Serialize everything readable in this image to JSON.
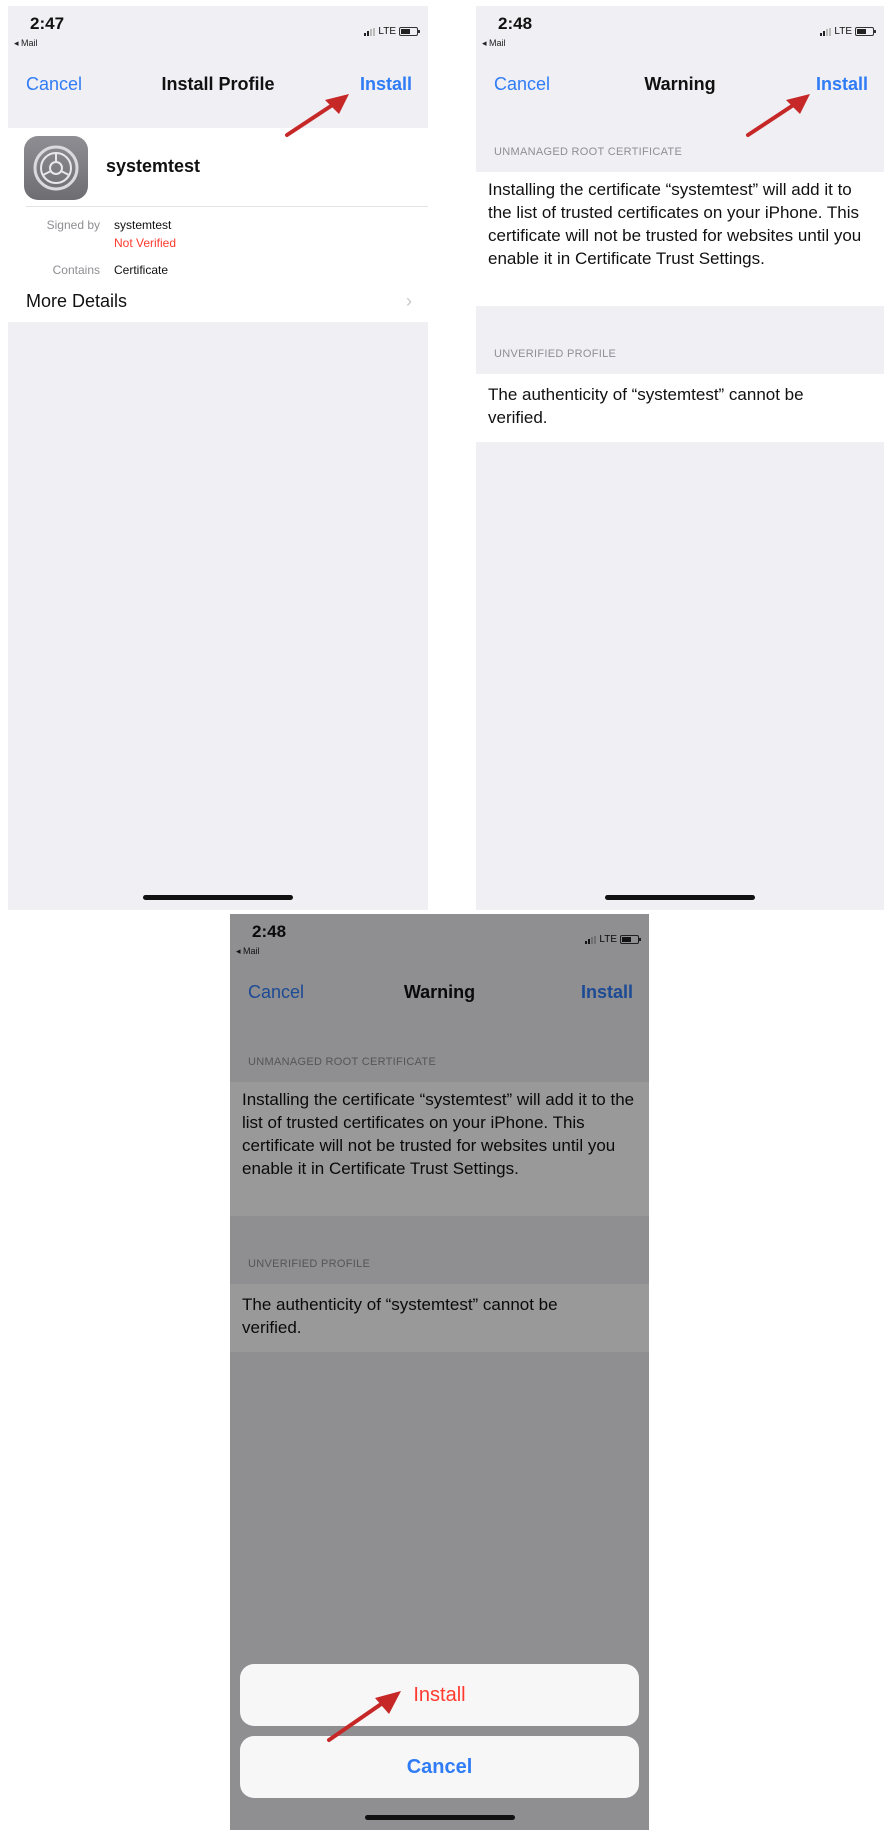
{
  "screens": [
    {
      "status": {
        "time": "2:47",
        "back": "◂ Mail",
        "network": "LTE"
      },
      "nav": {
        "cancel": "Cancel",
        "title": "Install Profile",
        "install": "Install"
      },
      "profile": {
        "name": "systemtest",
        "signed_by_label": "Signed by",
        "signed_by_value": "systemtest",
        "verification": "Not Verified",
        "contains_label": "Contains",
        "contains_value": "Certificate",
        "more_details": "More Details"
      }
    },
    {
      "status": {
        "time": "2:48",
        "back": "◂ Mail",
        "network": "LTE"
      },
      "nav": {
        "cancel": "Cancel",
        "title": "Warning",
        "install": "Install"
      },
      "sections": [
        {
          "header": "UNMANAGED ROOT CERTIFICATE",
          "text": "Installing the certificate “systemtest” will add it to the list of trusted certificates on your iPhone. This certificate will not be trusted for websites until you enable it in Certificate Trust Settings."
        },
        {
          "header": "UNVERIFIED PROFILE",
          "text": "The authenticity of “systemtest” cannot be verified."
        }
      ]
    },
    {
      "status": {
        "time": "2:48",
        "back": "◂ Mail",
        "network": "LTE"
      },
      "nav": {
        "cancel": "Cancel",
        "title": "Warning",
        "install": "Install"
      },
      "sections": [
        {
          "header": "UNMANAGED ROOT CERTIFICATE",
          "text": "Installing the certificate “systemtest” will add it to the list of trusted certificates on your iPhone. This certificate will not be trusted for websites until you enable it in Certificate Trust Settings."
        },
        {
          "header": "UNVERIFIED PROFILE",
          "text": "The authenticity of “systemtest” cannot be verified."
        }
      ],
      "action_sheet": {
        "install": "Install",
        "cancel": "Cancel"
      }
    }
  ],
  "colors": {
    "accent": "#2f7cf6",
    "destructive": "#ff3b30",
    "annotation_arrow": "#c62828"
  },
  "icons": {
    "signal": "signal-bars-icon",
    "battery": "battery-icon",
    "disclosure": "chevron-right-icon",
    "settings": "settings-gear-icon",
    "annotation": "red-arrow-icon"
  }
}
